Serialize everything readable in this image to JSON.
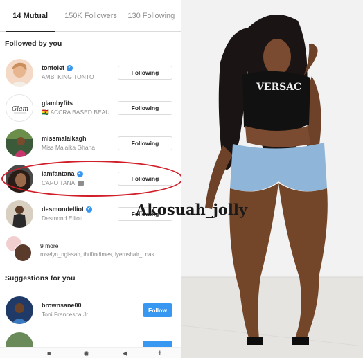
{
  "tabs": [
    {
      "label": "14 Mutual",
      "active": true
    },
    {
      "label": "150K Followers",
      "active": false
    },
    {
      "label": "130 Following",
      "active": false
    }
  ],
  "followed_by_you": {
    "title": "Followed by you",
    "rows": [
      {
        "username": "tontolet",
        "subtitle": "AMB. KING TONTO",
        "verified": true,
        "button": "Following"
      },
      {
        "username": "glambyfits",
        "subtitle": "🇬🇭 ACCRA BASED BEAU...",
        "verified": false,
        "button": "Following"
      },
      {
        "username": "missmalaikagh",
        "subtitle": "Miss Malaika Ghana",
        "verified": false,
        "button": "Following"
      },
      {
        "username": "iamfantana",
        "subtitle": "CAPO TANA",
        "verified": true,
        "button": "Following"
      },
      {
        "username": "desmondelliot",
        "subtitle": "Desmond Elliott",
        "verified": true,
        "button": "Following"
      }
    ],
    "more": {
      "label": "9 more",
      "names": "roselyn_ngissah, thriftndimes, lyernshair_, nas..."
    }
  },
  "suggestions": {
    "title": "Suggestions for you",
    "rows": [
      {
        "username": "brownsane00",
        "subtitle": "Toni Francesca Jr",
        "button": "Follow"
      }
    ]
  },
  "watermark": "Akosuah_jolly",
  "colors": {
    "accent_blue": "#3897f0",
    "highlight_red": "#d11f2a"
  }
}
